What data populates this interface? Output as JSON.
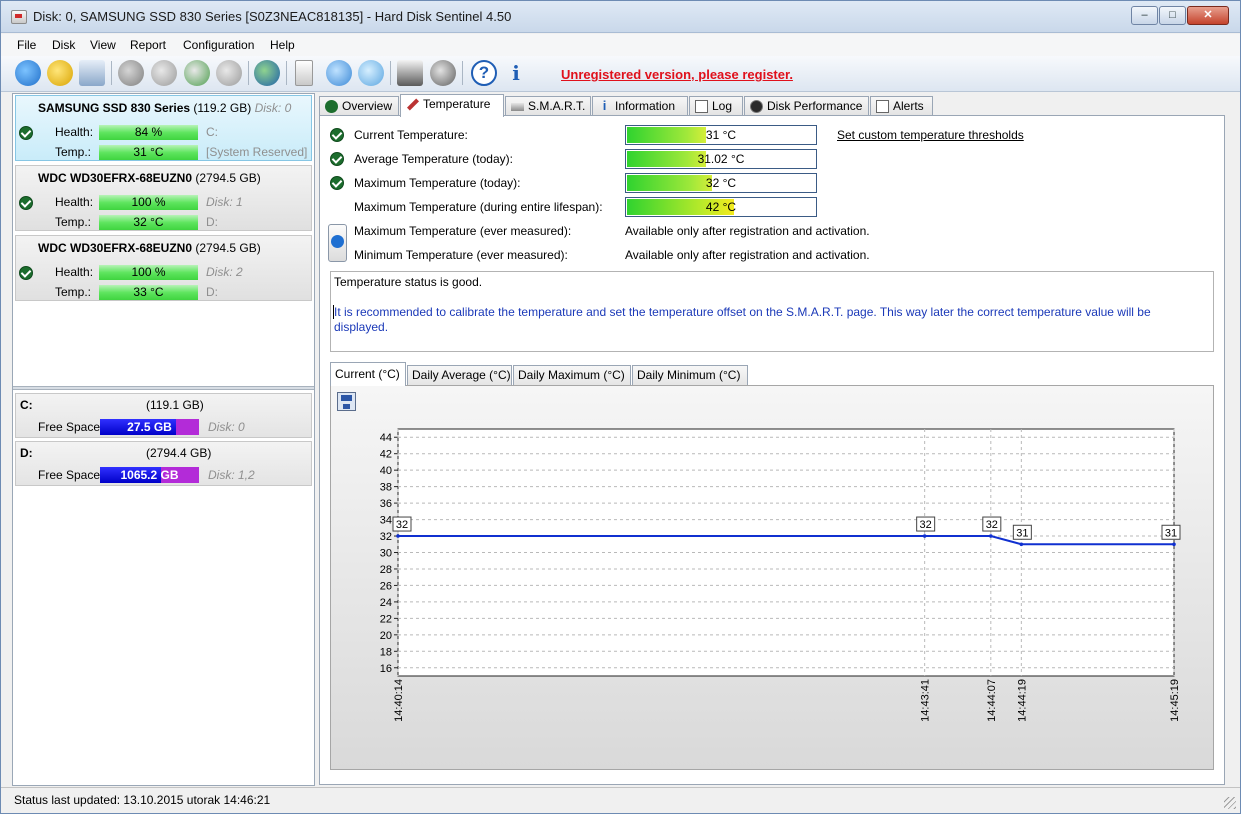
{
  "window": {
    "title": "Disk: 0, SAMSUNG SSD 830 Series [S0Z3NEAC818135]  -  Hard Disk Sentinel 4.50"
  },
  "menu": [
    "File",
    "Disk",
    "View",
    "Report",
    "Configuration",
    "Help"
  ],
  "toolbar": {
    "icons": [
      "refresh-icon",
      "warning-icon",
      "disk-icon",
      "disk-tools-icon",
      "disk-check-icon",
      "disk-repair-icon",
      "disk-info-icon",
      "globe-icon",
      "report-icon",
      "sync-icon",
      "network-icon",
      "chart-icon",
      "sound-icon",
      "help-icon",
      "about-icon"
    ],
    "register_text": "Unregistered version, please register.",
    "register_color": "#e0101b"
  },
  "disks": [
    {
      "name": "SAMSUNG SSD 830 Series",
      "size": "(119.2 GB)",
      "index": "Disk: 0",
      "health": "84 %",
      "health_pct": 84,
      "temp": "31 °C",
      "note1": "C:",
      "note2": "[System Reserved]",
      "selected": true
    },
    {
      "name": "WDC WD30EFRX-68EUZN0",
      "size": "(2794.5 GB)",
      "index": "",
      "health": "100 %",
      "health_pct": 100,
      "temp": "32 °C",
      "note1": "Disk: 1",
      "note2": "D:",
      "selected": false
    },
    {
      "name": "WDC WD30EFRX-68EUZN0",
      "size": "(2794.5 GB)",
      "index": "",
      "health": "100 %",
      "health_pct": 100,
      "temp": "33 °C",
      "note1": "Disk: 2",
      "note2": "D:",
      "selected": false
    }
  ],
  "labels": {
    "health": "Health:",
    "temp": "Temp.:",
    "free_space": "Free Space"
  },
  "partitions": [
    {
      "letter": "C:",
      "size": "(119.1 GB)",
      "free": "27.5 GB",
      "free_ratio": 0.77,
      "disk": "Disk: 0"
    },
    {
      "letter": "D:",
      "size": "(2794.4 GB)",
      "free": "1065.2 GB",
      "free_ratio": 0.62,
      "disk": "Disk: 1,2"
    }
  ],
  "tabs": [
    "Overview",
    "Temperature",
    "S.M.A.R.T.",
    "Information",
    "Log",
    "Disk Performance",
    "Alerts"
  ],
  "active_tab": "Temperature",
  "temperature": {
    "rows": [
      {
        "label": "Current Temperature:",
        "value": "31 °C",
        "level": 0.42
      },
      {
        "label": "Average Temperature (today):",
        "value": "31.02 °C",
        "level": 0.42
      },
      {
        "label": "Maximum Temperature (today):",
        "value": "32 °C",
        "level": 0.45
      },
      {
        "label": "Maximum Temperature (during entire lifespan):",
        "value": "42 °C",
        "level": 0.57
      }
    ],
    "threshold_link": "Set custom temperature thresholds",
    "ever_max_label": "Maximum Temperature (ever measured):",
    "ever_min_label": "Minimum Temperature (ever measured):",
    "ever_note": "Available only after registration and activation.",
    "status": "Temperature status is good.",
    "recommendation": "It is recommended to calibrate the temperature and set the temperature offset on the S.M.A.R.T. page. This way later the correct temperature value will be displayed."
  },
  "chart_tabs": [
    "Current (°C)",
    "Daily Average (°C)",
    "Daily Maximum (°C)",
    "Daily Minimum (°C)"
  ],
  "chart_data": {
    "type": "line",
    "title": "",
    "xlabel": "",
    "ylabel": "",
    "x": [
      "14:40:14",
      "14:43:41",
      "14:44:07",
      "14:44:19",
      "14:45:19"
    ],
    "x_seconds": [
      0,
      207,
      233,
      245,
      305
    ],
    "series": [
      {
        "values": [
          32,
          32,
          32,
          31,
          31
        ],
        "color": "#1030d0"
      }
    ],
    "ylim": [
      15,
      45
    ],
    "yticks": [
      16,
      18,
      20,
      22,
      24,
      26,
      28,
      30,
      32,
      34,
      36,
      38,
      40,
      42,
      44
    ],
    "grid": true
  },
  "statusbar": {
    "text": "Status last updated: 13.10.2015 utorak 14:46:21"
  }
}
